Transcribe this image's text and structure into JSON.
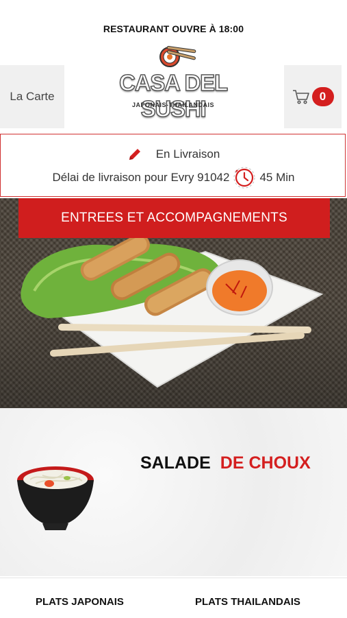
{
  "status": {
    "text": "RESTAURANT OUVRE À 18:00"
  },
  "header": {
    "menu_label": "La Carte",
    "cart_count": "0",
    "logo": {
      "name": "CASA DEL SUSHI",
      "tagline": "JAPONAIS-THAÏLANDAIS"
    }
  },
  "delivery": {
    "mode_label": "En Livraison",
    "delay_text": "Délai de livraison pour Evry 91042",
    "delay_value": "45 Min"
  },
  "category": {
    "title": "ENTREES ET ACCOMPAGNEMENTS"
  },
  "featured": {
    "title_part1": "SALADE",
    "title_part2": "DE CHOUX"
  },
  "bottom_nav": {
    "item1": "PLATS JAPONAIS",
    "item2": "PLATS THAILANDAIS"
  },
  "colors": {
    "accent": "#d41f1f",
    "banner": "#d01e1e",
    "header_btn_bg": "#f0f0f0"
  },
  "icons": [
    "pencil-icon",
    "clock-icon",
    "cart-icon",
    "sushi-logo-icon"
  ]
}
